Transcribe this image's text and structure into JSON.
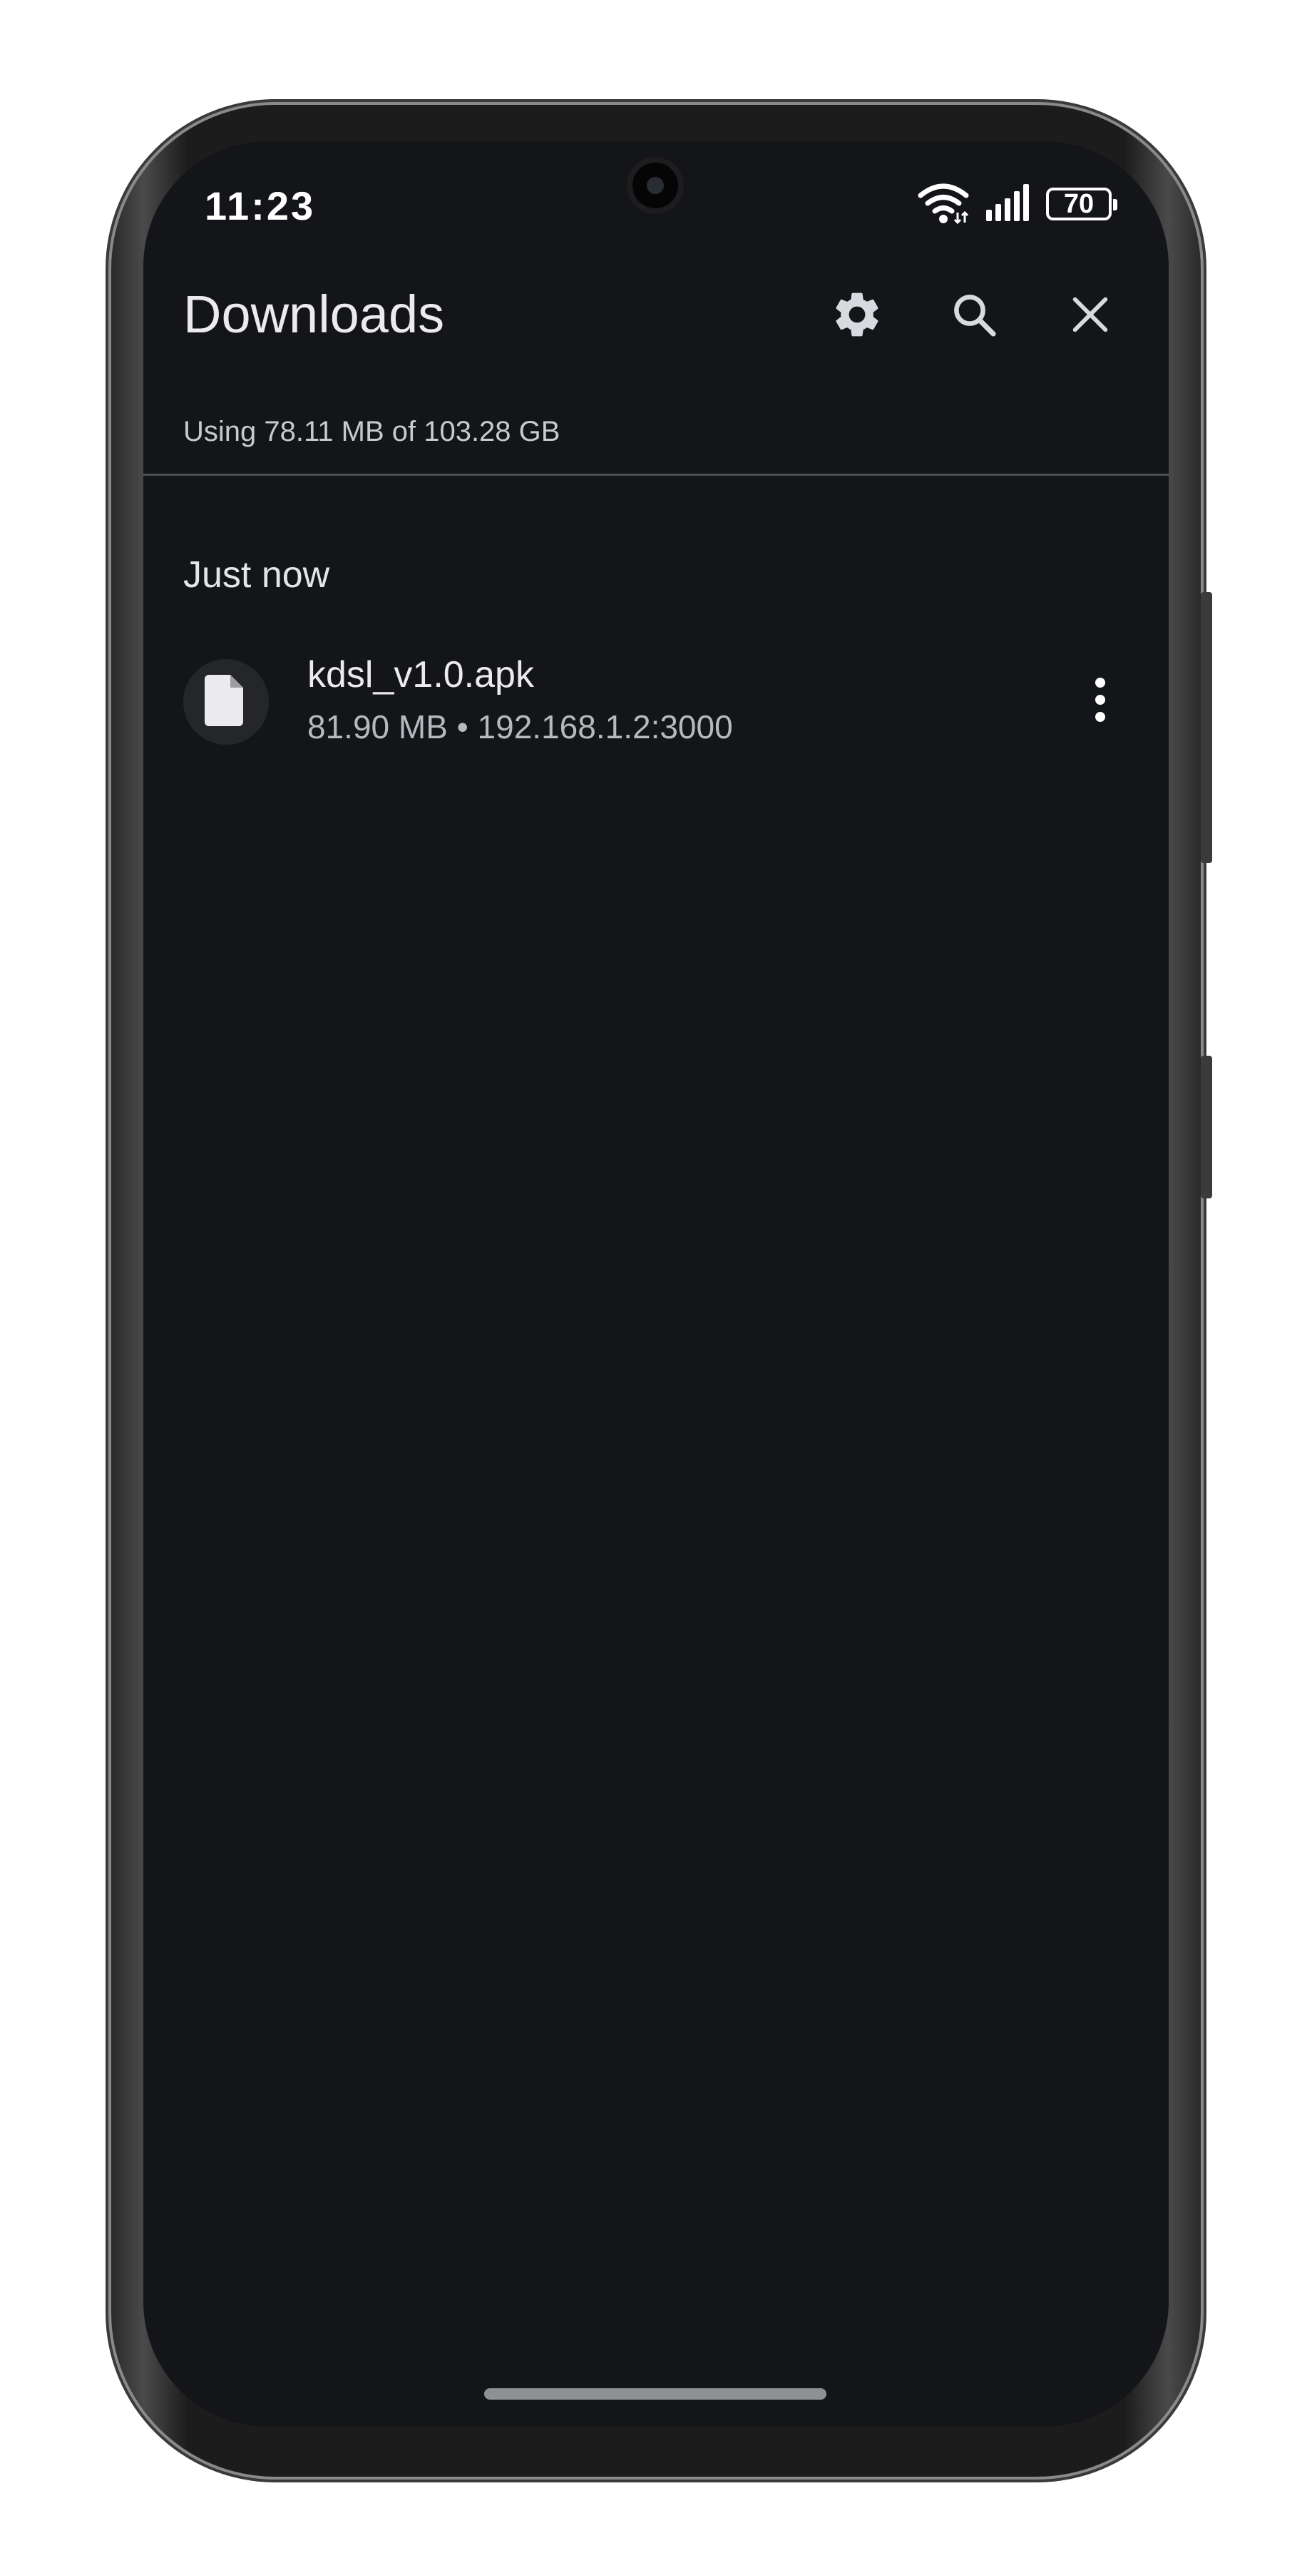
{
  "status_bar": {
    "time": "11:23",
    "battery": "70",
    "icons": [
      "wifi-icon",
      "signal-icon",
      "battery-icon"
    ]
  },
  "header": {
    "title": "Downloads",
    "actions": [
      "gear-icon",
      "search-icon",
      "close-icon"
    ]
  },
  "storage": {
    "usage_text": "Using 78.11 MB of 103.28 GB"
  },
  "sections": [
    {
      "header": "Just now",
      "items": [
        {
          "file_name": "kdsl_v1.0.apk",
          "meta": "81.90 MB • 192.168.1.2:3000",
          "icon": "file-icon"
        }
      ]
    }
  ],
  "colors": {
    "background": "#141519",
    "primary_text": "#ebebef",
    "secondary_text": "#b7b9bf",
    "icon": "#d9dadf",
    "divider": "#4b4d53"
  }
}
